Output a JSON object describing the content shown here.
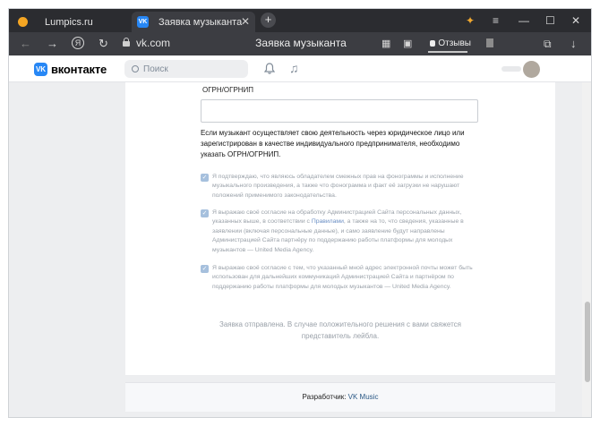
{
  "browser": {
    "tabs": [
      {
        "label": "Lumpics.ru"
      },
      {
        "label": "Заявка музыканта"
      }
    ],
    "new_tab_symbol": "+",
    "close_symbol": "✕",
    "window_controls": {
      "extension": "✦",
      "menu": "≡",
      "minimize": "—",
      "maximize": "☐",
      "close": "✕"
    },
    "url": "vk.com",
    "page_title": "Заявка музыканта",
    "reviews_label": "Отзывы",
    "icons": [
      "back-arrow-icon",
      "forward-arrow-icon",
      "yandex-icon",
      "reload-icon",
      "lock-icon",
      "translate-icon",
      "extension-icon",
      "bookmark-icon",
      "collections-icon",
      "download-icon"
    ]
  },
  "vk_header": {
    "logo_mark": "VK",
    "logo_text": "вконтакте",
    "search_placeholder": "Поиск"
  },
  "form": {
    "ogrn_label": "ОГРН/ОГРНИП",
    "ogrn_value": "",
    "notice": "Если музыкант осуществляет свою деятельность через юридическое лицо или зарегистрирован в качестве индивидуального предпринимателя, необходимо указать ОГРН/ОГРНИП.",
    "consents": [
      {
        "checked": true,
        "text": "Я подтверждаю, что являюсь обладателем смежных прав на фонограммы и исполнение музыкального произведения, а также что фонограмма и факт её загрузки не нарушают положений применимого законодательства."
      },
      {
        "checked": true,
        "text_before": "Я выражаю своё согласие на обработку Администрацией Сайта персональных данных, указанных выше, в соответствии с ",
        "link": "Правилами",
        "text_after": ", а также на то, что сведения, указанные в заявлении (включая персональные данные), и само заявление будут направлены Администрацией Сайта партнёру по поддержанию работы платформы для молодых музыкантов — United Media Agency."
      },
      {
        "checked": true,
        "text": "Я выражаю своё согласие с тем, что указанный мной адрес электронной почты может быть использован для дальнейших коммуникаций Администрацией Сайта и партнёром по поддержанию работы платформы для молодых музыкантов — United Media Agency."
      }
    ],
    "sent_message": "Заявка отправлена. В случае положительного решения с вами свяжется представитель лейбла."
  },
  "footer": {
    "developer_label": "Разработчик:",
    "developer_link": "VK Music"
  },
  "colors": {
    "tabbar": "#2b2c30",
    "addressbar": "#3c3d42",
    "vk_blue": "#2787f5",
    "page_bg": "#edeef0",
    "checkbox": "#a6c0dd",
    "link": "#2a5885"
  }
}
